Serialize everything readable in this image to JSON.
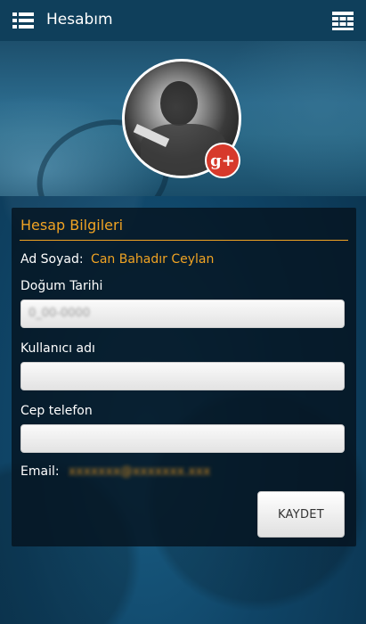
{
  "header": {
    "title": "Hesabım",
    "menu_icon": "list-menu-icon",
    "view_icon": "grid-view-icon"
  },
  "profile": {
    "social_badge": "g+",
    "avatar_icon": "profile-photo"
  },
  "account": {
    "section_title": "Hesap Bilgileri",
    "name_label": "Ad Soyad:",
    "name_value": "Can Bahadır Ceylan",
    "birthdate_label": "Doğum Tarihi",
    "birthdate_value": "0_00-0000",
    "username_label": "Kullanıcı adı",
    "username_value": "",
    "phone_label": "Cep telefon",
    "phone_value": "",
    "email_label": "Email:",
    "email_value": "xxxxxxx@xxxxxxx.xxx",
    "save_label": "KAYDET"
  },
  "colors": {
    "accent": "#f0a323",
    "topbar": "#0f3f5b",
    "badge": "#d7392b"
  }
}
